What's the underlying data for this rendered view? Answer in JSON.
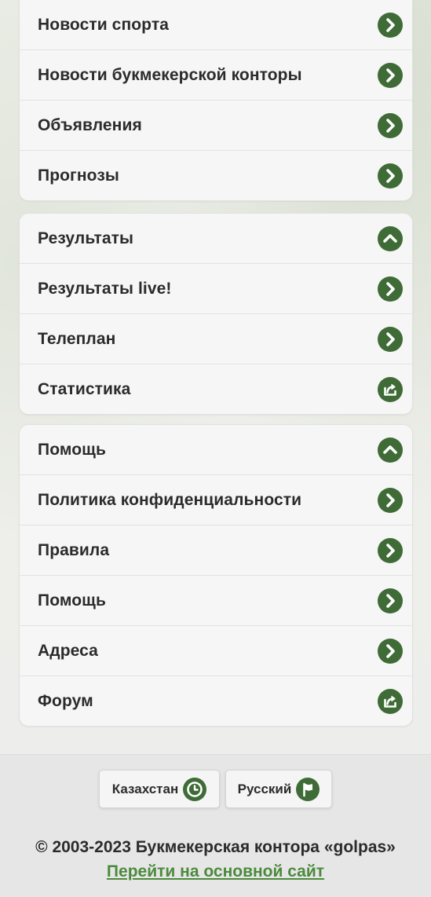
{
  "menu_groups": [
    {
      "items": [
        {
          "label": "Новости спорта",
          "icon": "chevron-right-icon"
        },
        {
          "label": "Новости букмекерской конторы",
          "icon": "chevron-right-icon"
        },
        {
          "label": "Объявления",
          "icon": "chevron-right-icon"
        },
        {
          "label": "Прогнозы",
          "icon": "chevron-right-icon"
        }
      ]
    },
    {
      "items": [
        {
          "label": "Результаты",
          "icon": "chevron-up-icon"
        },
        {
          "label": "Результаты live!",
          "icon": "chevron-right-icon"
        },
        {
          "label": "Телеплан",
          "icon": "chevron-right-icon"
        },
        {
          "label": "Статистика",
          "icon": "external-link-icon"
        }
      ]
    },
    {
      "items": [
        {
          "label": "Помощь",
          "icon": "chevron-up-icon"
        },
        {
          "label": "Политика конфиденциальности",
          "icon": "chevron-right-icon"
        },
        {
          "label": "Правила",
          "icon": "chevron-right-icon"
        },
        {
          "label": "Помощь",
          "icon": "chevron-right-icon"
        },
        {
          "label": "Адреса",
          "icon": "chevron-right-icon"
        },
        {
          "label": "Форум",
          "icon": "external-link-icon"
        }
      ]
    }
  ],
  "footer": {
    "region_button": {
      "label": "Казахстан",
      "icon": "clock-icon"
    },
    "language_button": {
      "label": "Русский",
      "icon": "flag-icon"
    },
    "copyright": "© 2003-2023 Букмекерская контора «golpas»",
    "main_site_link": "Перейти на основной сайт"
  },
  "colors": {
    "accent": "#3f6b37",
    "link": "#4b8a3c",
    "text": "#2b2b2b",
    "card_bg": "#f6f6f6"
  }
}
